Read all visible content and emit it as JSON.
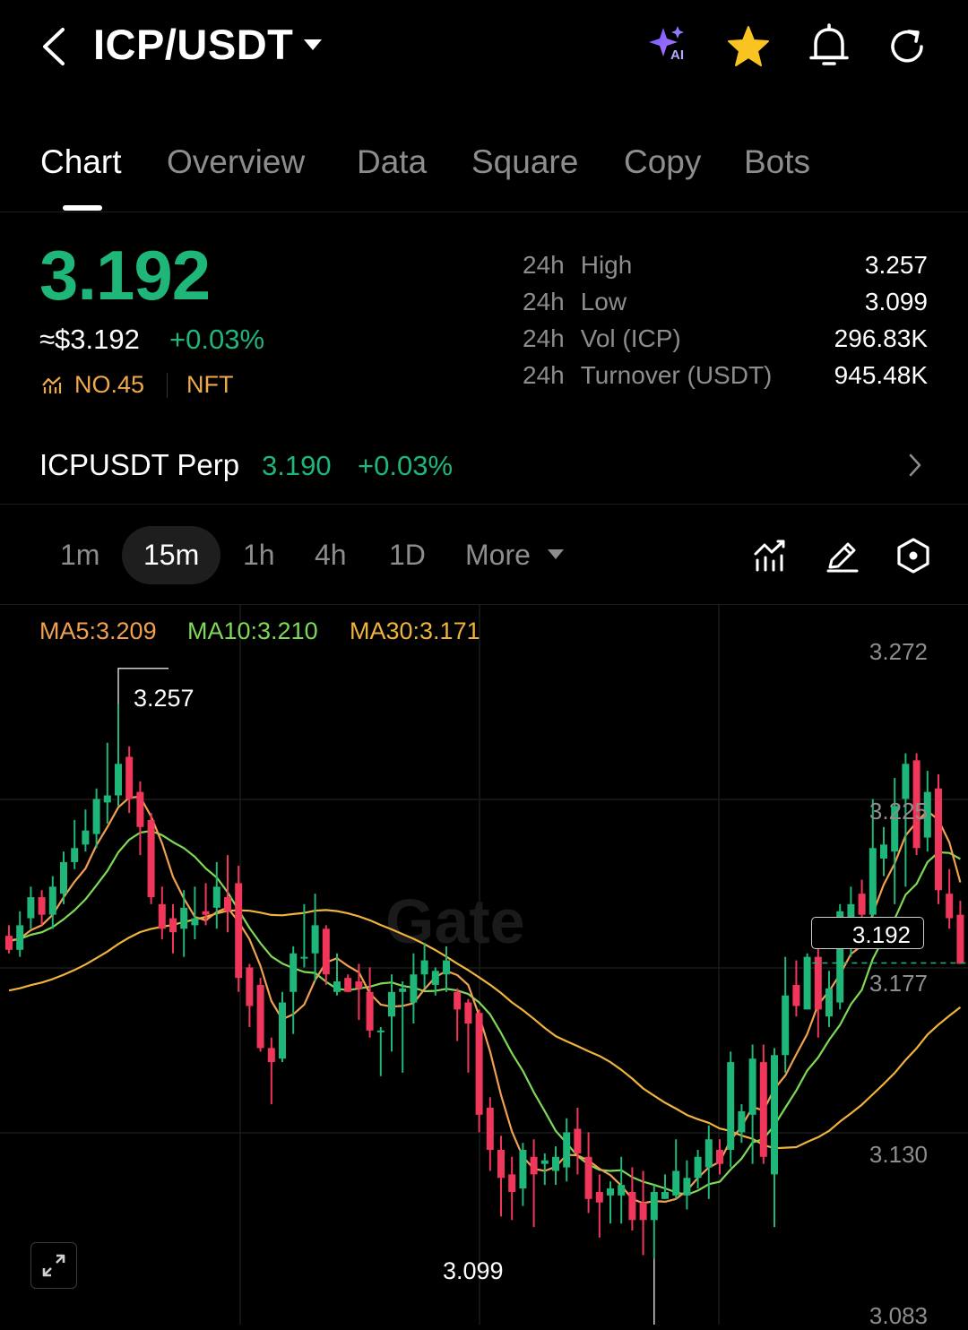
{
  "header": {
    "title": "ICP/USDT",
    "ai_badge": "AI",
    "icons": [
      "back-arrow-icon",
      "dropdown-caret-icon",
      "ai-sparkle-icon",
      "favorite-star-icon",
      "bell-icon",
      "refresh-icon"
    ]
  },
  "tabs": [
    {
      "label": "Chart",
      "active": true
    },
    {
      "label": "Overview"
    },
    {
      "label": "Data"
    },
    {
      "label": "Square"
    },
    {
      "label": "Copy"
    },
    {
      "label": "Bots"
    }
  ],
  "ticker": {
    "last_price": "3.192",
    "usd_price": "≈$3.192",
    "change_pct": "+0.03%",
    "rank": "NO.45",
    "tag": "NFT",
    "stats": [
      {
        "period": "24h",
        "label": "High",
        "value": "3.257"
      },
      {
        "period": "24h",
        "label": "Low",
        "value": "3.099"
      },
      {
        "period": "24h",
        "label": "Vol (ICP)",
        "value": "296.83K"
      },
      {
        "period": "24h",
        "label": "Turnover (USDT)",
        "value": "945.48K"
      }
    ]
  },
  "perp": {
    "name": "ICPUSDT Perp",
    "price": "3.190",
    "change_pct": "+0.03%"
  },
  "intervals": [
    {
      "label": "1m"
    },
    {
      "label": "15m",
      "active": true
    },
    {
      "label": "1h"
    },
    {
      "label": "4h"
    },
    {
      "label": "1D"
    },
    {
      "label": "More"
    }
  ],
  "chart_data": {
    "type": "candlestick",
    "indicators": [
      {
        "name": "MA5",
        "label": "MA5:3.209",
        "color": "#f0a050"
      },
      {
        "name": "MA10",
        "label": "MA10:3.210",
        "color": "#7ed957"
      },
      {
        "name": "MA30",
        "label": "MA30:3.171",
        "color": "#f0b33c"
      }
    ],
    "y_axis_labels": [
      "3.272",
      "3.225",
      "3.177",
      "3.130",
      "3.083"
    ],
    "ylim": [
      3.083,
      3.272
    ],
    "high_marker": "3.257",
    "low_marker": "3.099",
    "current_price": "3.192",
    "watermark": "Gate",
    "up_color": "#1fb67a",
    "down_color": "#f0365a",
    "candles": [
      [
        3.191,
        3.187,
        3.194,
        3.186
      ],
      [
        3.187,
        3.194,
        3.198,
        3.185
      ],
      [
        3.196,
        3.202,
        3.205,
        3.193
      ],
      [
        3.202,
        3.197,
        3.204,
        3.194
      ],
      [
        3.197,
        3.205,
        3.208,
        3.193
      ],
      [
        3.203,
        3.212,
        3.215,
        3.2
      ],
      [
        3.212,
        3.216,
        3.224,
        3.21
      ],
      [
        3.217,
        3.221,
        3.227,
        3.215
      ],
      [
        3.22,
        3.23,
        3.233,
        3.216
      ],
      [
        3.229,
        3.231,
        3.246,
        3.223
      ],
      [
        3.231,
        3.24,
        3.257,
        3.228
      ],
      [
        3.242,
        3.23,
        3.245,
        3.226
      ],
      [
        3.232,
        3.222,
        3.235,
        3.214
      ],
      [
        3.224,
        3.202,
        3.226,
        3.2
      ],
      [
        3.2,
        3.193,
        3.205,
        3.19
      ],
      [
        3.196,
        3.192,
        3.2,
        3.186
      ],
      [
        3.193,
        3.199,
        3.204,
        3.185
      ],
      [
        3.194,
        3.196,
        3.205,
        3.19
      ],
      [
        3.198,
        3.197,
        3.206,
        3.194
      ],
      [
        3.199,
        3.205,
        3.212,
        3.193
      ],
      [
        3.202,
        3.198,
        3.214,
        3.192
      ],
      [
        3.206,
        3.179,
        3.211,
        3.175
      ],
      [
        3.182,
        3.171,
        3.183,
        3.165
      ],
      [
        3.177,
        3.159,
        3.179,
        3.158
      ],
      [
        3.159,
        3.155,
        3.162,
        3.143
      ],
      [
        3.156,
        3.172,
        3.175,
        3.155
      ],
      [
        3.175,
        3.186,
        3.188,
        3.163
      ],
      [
        3.185,
        3.185,
        3.2,
        3.182
      ],
      [
        3.186,
        3.194,
        3.203,
        3.178
      ],
      [
        3.193,
        3.18,
        3.194,
        3.177
      ],
      [
        3.175,
        3.178,
        3.186,
        3.174
      ],
      [
        3.179,
        3.175,
        3.18,
        3.175
      ],
      [
        3.178,
        3.176,
        3.183,
        3.167
      ],
      [
        3.175,
        3.164,
        3.182,
        3.162
      ],
      [
        3.164,
        3.164,
        3.165,
        3.151
      ],
      [
        3.168,
        3.175,
        3.18,
        3.158
      ],
      [
        3.175,
        3.176,
        3.178,
        3.152
      ],
      [
        3.172,
        3.18,
        3.186,
        3.166
      ],
      [
        3.18,
        3.184,
        3.189,
        3.176
      ],
      [
        3.177,
        3.181,
        3.182,
        3.174
      ],
      [
        3.18,
        3.184,
        3.188,
        3.175
      ],
      [
        3.175,
        3.17,
        3.176,
        3.161
      ],
      [
        3.172,
        3.166,
        3.173,
        3.152
      ],
      [
        3.169,
        3.14,
        3.17,
        3.135
      ],
      [
        3.142,
        3.13,
        3.145,
        3.124
      ],
      [
        3.13,
        3.122,
        3.134,
        3.111
      ],
      [
        3.123,
        3.118,
        3.128,
        3.11
      ],
      [
        3.119,
        3.13,
        3.132,
        3.114
      ],
      [
        3.128,
        3.123,
        3.133,
        3.108
      ],
      [
        3.126,
        3.127,
        3.129,
        3.12
      ],
      [
        3.124,
        3.128,
        3.131,
        3.12
      ],
      [
        3.125,
        3.135,
        3.139,
        3.121
      ],
      [
        3.136,
        3.129,
        3.142,
        3.123
      ],
      [
        3.128,
        3.116,
        3.135,
        3.112
      ],
      [
        3.118,
        3.115,
        3.123,
        3.105
      ],
      [
        3.117,
        3.119,
        3.121,
        3.109
      ],
      [
        3.117,
        3.12,
        3.128,
        3.109
      ],
      [
        3.118,
        3.11,
        3.125,
        3.107
      ],
      [
        3.115,
        3.11,
        3.124,
        3.1
      ],
      [
        3.11,
        3.118,
        3.12,
        3.099
      ],
      [
        3.116,
        3.118,
        3.123,
        3.116
      ],
      [
        3.117,
        3.124,
        3.133,
        3.116
      ],
      [
        3.117,
        3.122,
        3.127,
        3.113
      ],
      [
        3.122,
        3.128,
        3.13,
        3.119
      ],
      [
        3.125,
        3.133,
        3.137,
        3.116
      ],
      [
        3.13,
        3.126,
        3.133,
        3.123
      ],
      [
        3.13,
        3.155,
        3.158,
        3.125
      ],
      [
        3.135,
        3.141,
        3.143,
        3.132
      ],
      [
        3.14,
        3.156,
        3.16,
        3.126
      ],
      [
        3.155,
        3.128,
        3.16,
        3.126
      ],
      [
        3.123,
        3.157,
        3.159,
        3.108
      ],
      [
        3.157,
        3.174,
        3.185,
        3.152
      ],
      [
        3.177,
        3.171,
        3.184,
        3.168
      ],
      [
        3.17,
        3.185,
        3.186,
        3.17
      ],
      [
        3.185,
        3.17,
        3.188,
        3.162
      ],
      [
        3.168,
        3.176,
        3.181,
        3.165
      ],
      [
        3.172,
        3.198,
        3.2,
        3.17
      ],
      [
        3.19,
        3.2,
        3.205,
        3.185
      ],
      [
        3.203,
        3.197,
        3.207,
        3.193
      ],
      [
        3.197,
        3.216,
        3.23,
        3.195
      ],
      [
        3.213,
        3.217,
        3.222,
        3.208
      ],
      [
        3.215,
        3.228,
        3.236,
        3.2
      ],
      [
        3.23,
        3.24,
        3.243,
        3.205
      ],
      [
        3.241,
        3.216,
        3.243,
        3.214
      ],
      [
        3.219,
        3.232,
        3.238,
        3.215
      ],
      [
        3.233,
        3.204,
        3.237,
        3.2
      ],
      [
        3.203,
        3.196,
        3.21,
        3.193
      ],
      [
        3.197,
        3.183,
        3.201,
        3.183
      ]
    ]
  }
}
